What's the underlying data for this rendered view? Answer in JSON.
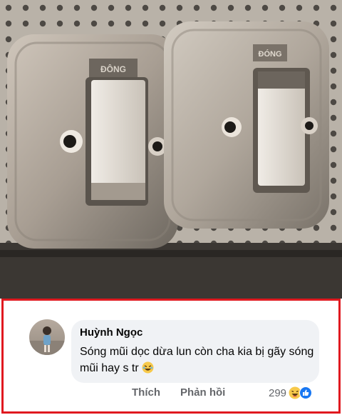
{
  "photo": {
    "subject": "two-light-switches-with-eyes",
    "switch_labels": [
      "ĐÔNG",
      "ĐÓNG"
    ]
  },
  "comment": {
    "author": "Huỳnh Ngọc",
    "text": "Sóng mũi dọc dừa lun còn cha kia bị gãy sóng mũi hay s tr",
    "text_emoji": "laughing-face-emoji",
    "actions": {
      "like": "Thích",
      "reply": "Phản hồi"
    },
    "reactions": {
      "count": "299",
      "icons": [
        "haha-reaction-icon",
        "like-reaction-icon"
      ]
    }
  },
  "colors": {
    "highlight_border": "#e0191f",
    "bubble": "#f0f2f5",
    "muted_text": "#65676b",
    "like_blue": "#1877f2",
    "haha_yellow": "#f7c94a"
  }
}
